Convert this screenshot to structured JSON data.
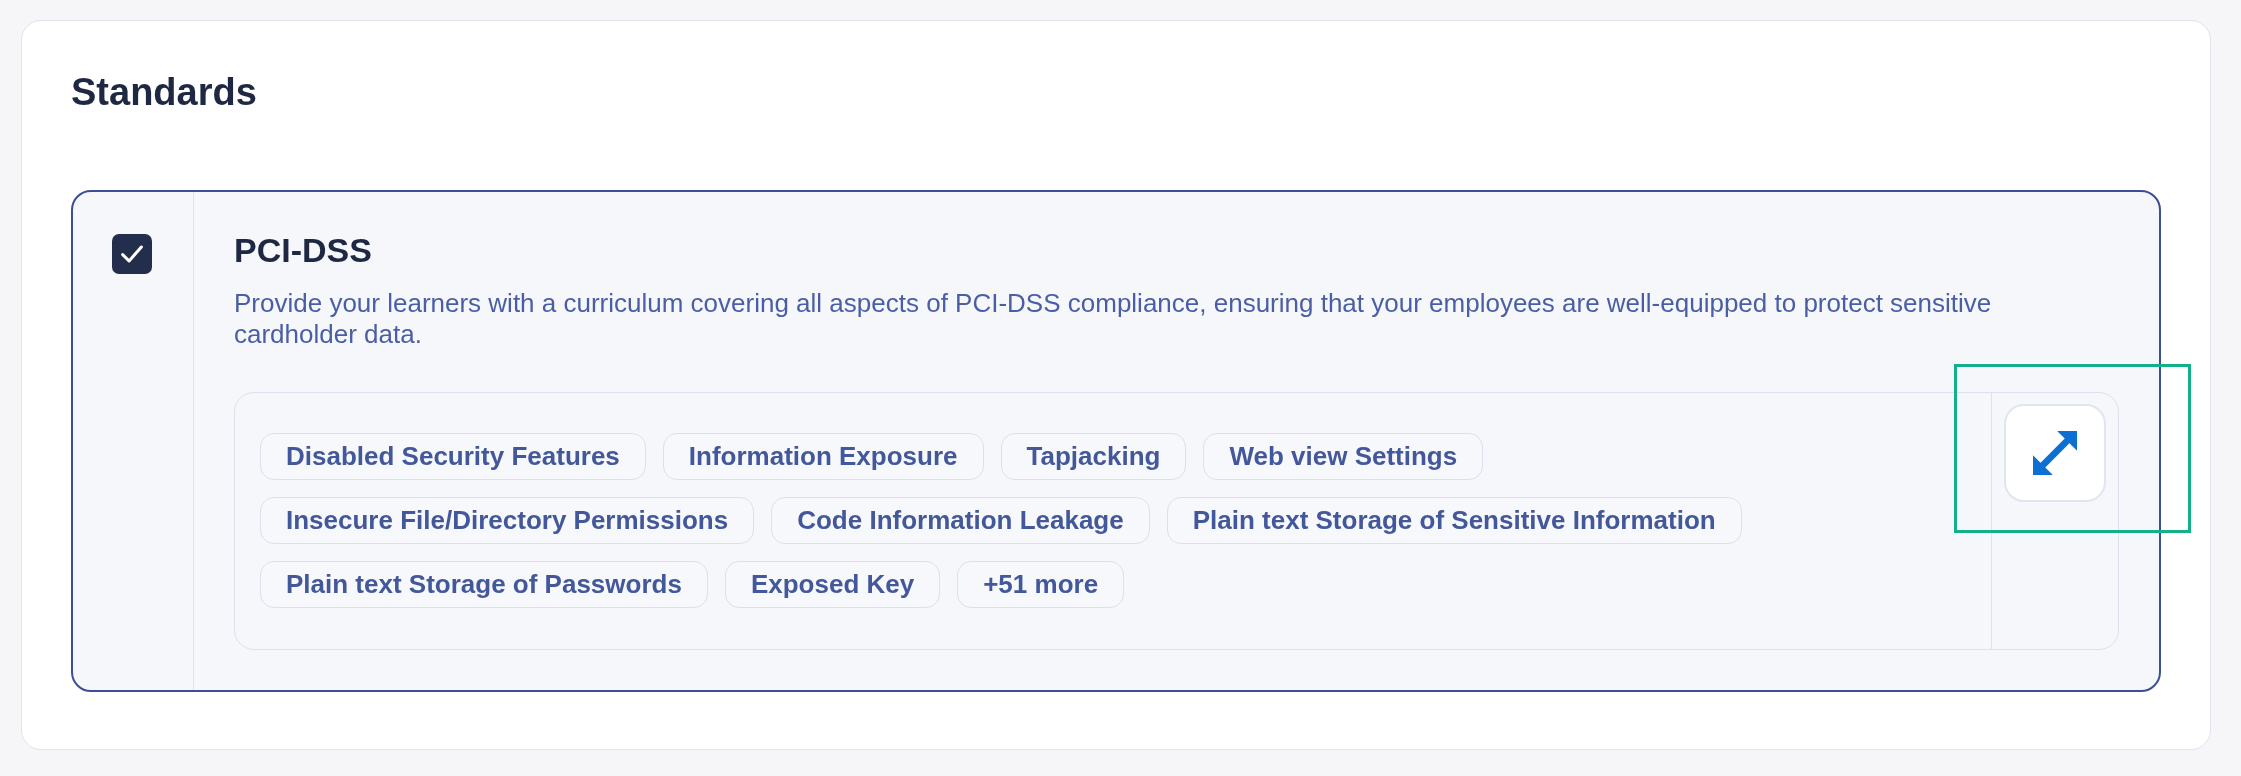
{
  "section": {
    "title": "Standards"
  },
  "standards": [
    {
      "checked": true,
      "title": "PCI-DSS",
      "description": "Provide your learners with a curriculum covering all aspects of PCI-DSS compliance, ensuring that your employees are well-equipped to protect sensitive cardholder data.",
      "tags": [
        "Disabled Security Features",
        "Information Exposure",
        "Tapjacking",
        "Web view Settings",
        "Insecure File/Directory Permissions",
        "Code Information Leakage",
        "Plain text Storage of Sensitive Information",
        "Plain text Storage of Passwords",
        "Exposed Key"
      ],
      "more": "+51 more",
      "expand_button": {
        "highlighted": true
      }
    }
  ]
}
